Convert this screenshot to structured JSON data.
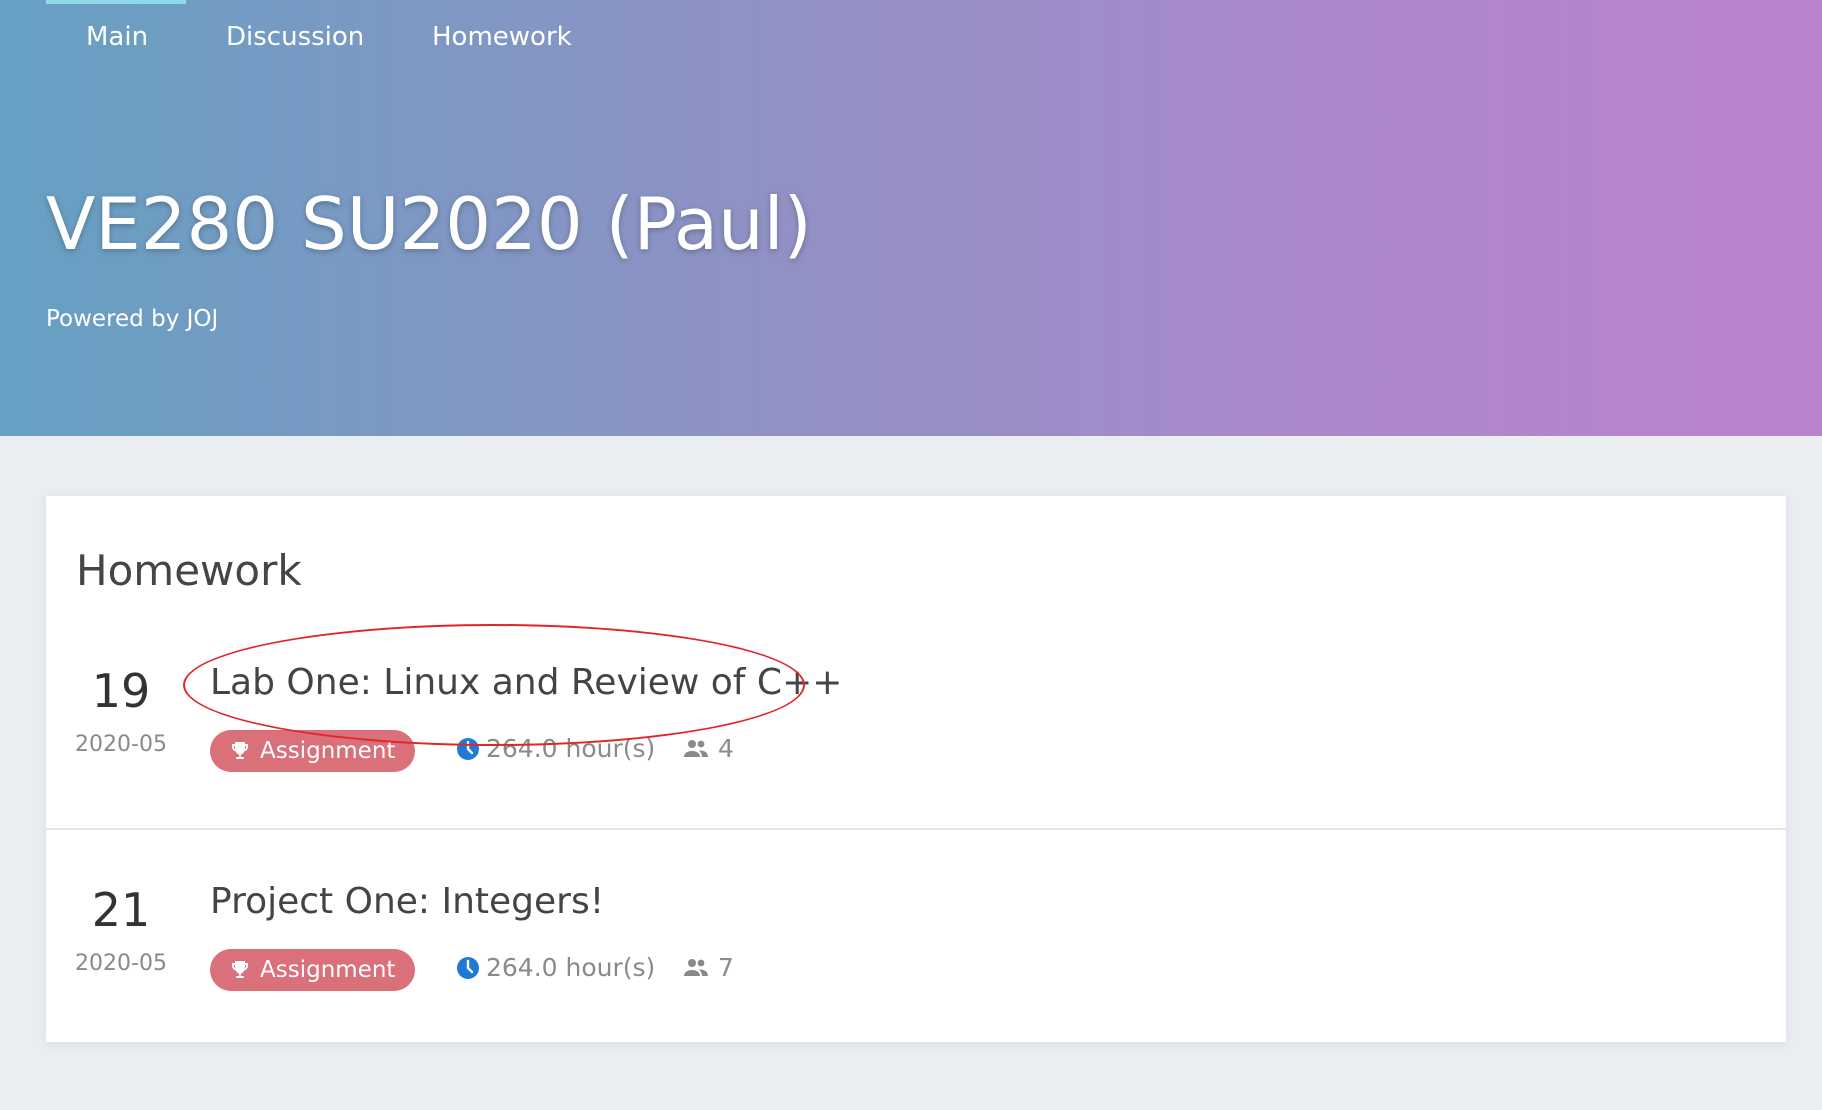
{
  "nav": {
    "items": [
      {
        "label": "Main",
        "active": true
      },
      {
        "label": "Discussion",
        "active": false
      },
      {
        "label": "Homework",
        "active": false
      }
    ]
  },
  "hero": {
    "title": "VE280 SU2020 (Paul)",
    "subtitle": "Powered by JOJ"
  },
  "homework": {
    "heading": "Homework",
    "items": [
      {
        "day": "19",
        "month": "2020-05",
        "title": "Lab One: Linux and Review of C++",
        "badge": "Assignment",
        "duration": "264.0 hour(s)",
        "participants": "4",
        "highlighted": true
      },
      {
        "day": "21",
        "month": "2020-05",
        "title": "Project One: Integers!",
        "badge": "Assignment",
        "duration": "264.0 hour(s)",
        "participants": "7",
        "highlighted": false
      }
    ]
  },
  "icons": {
    "badge_icon": "trophy-icon",
    "time_icon": "clock-icon",
    "participants_icon": "users-icon"
  },
  "colors": {
    "badge": "#d9707a",
    "clock": "#1f7ad6",
    "annotation": "#e0262a",
    "nav_active": "#8fd8e8"
  }
}
